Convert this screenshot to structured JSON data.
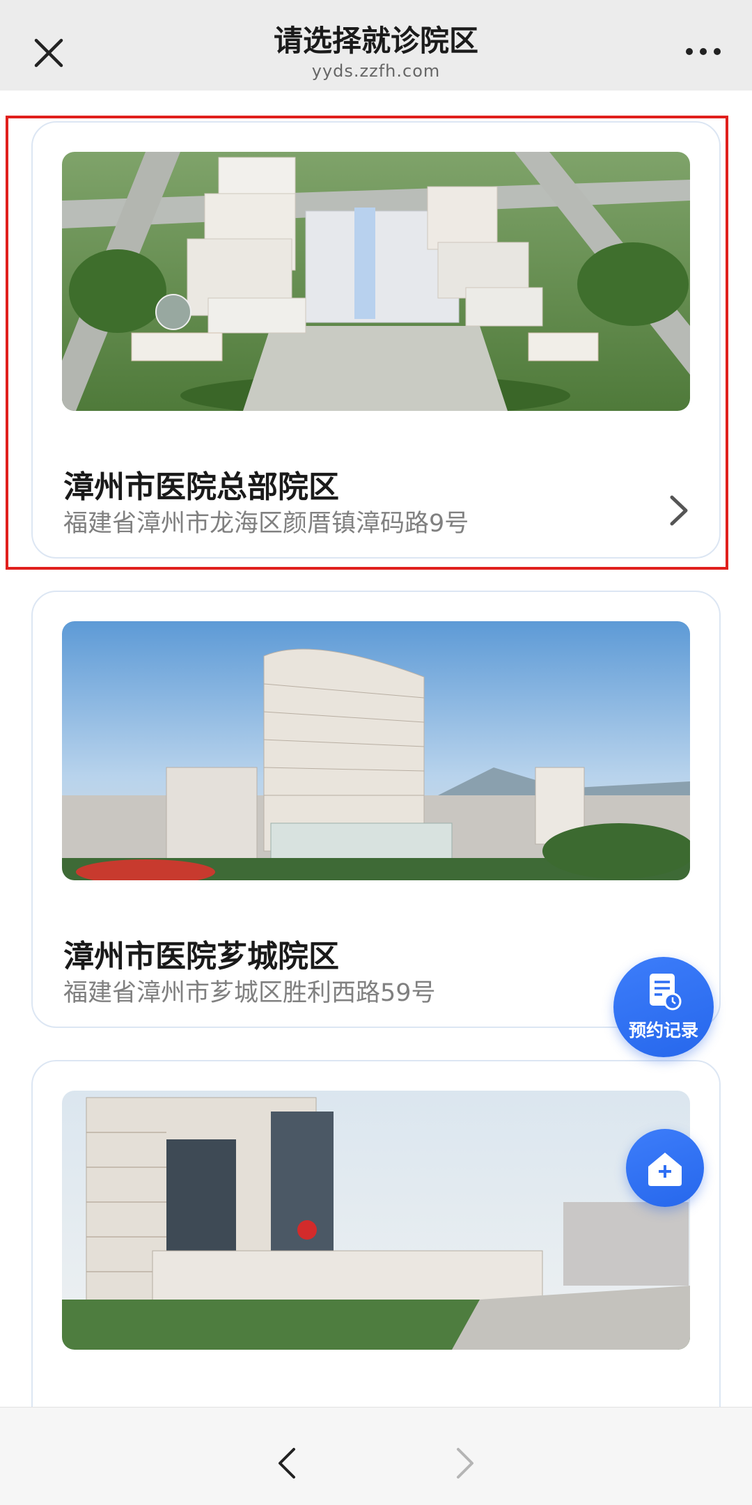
{
  "header": {
    "title": "请选择就诊院区",
    "subtitle": "yyds.zzfh.com",
    "close_icon": "close-icon",
    "more_icon": "more-icon"
  },
  "campuses": [
    {
      "name": "漳州市医院总部院区",
      "address": "福建省漳州市龙海区颜厝镇漳码路9号",
      "selected": true
    },
    {
      "name": "漳州市医院芗城院区",
      "address": "福建省漳州市芗城区胜利西路59号",
      "selected": false
    },
    {
      "name": "",
      "address": "",
      "selected": false
    }
  ],
  "floating": {
    "records_label": "预约记录",
    "records_icon": "document-clock-icon",
    "home_icon": "home-plus-icon",
    "accent": "#2f6ff3"
  },
  "bottom_nav": {
    "back_icon": "chevron-left-icon",
    "forward_icon": "chevron-right-icon"
  },
  "colors": {
    "highlight": "#e0201d",
    "card_border": "#dce6f3"
  }
}
